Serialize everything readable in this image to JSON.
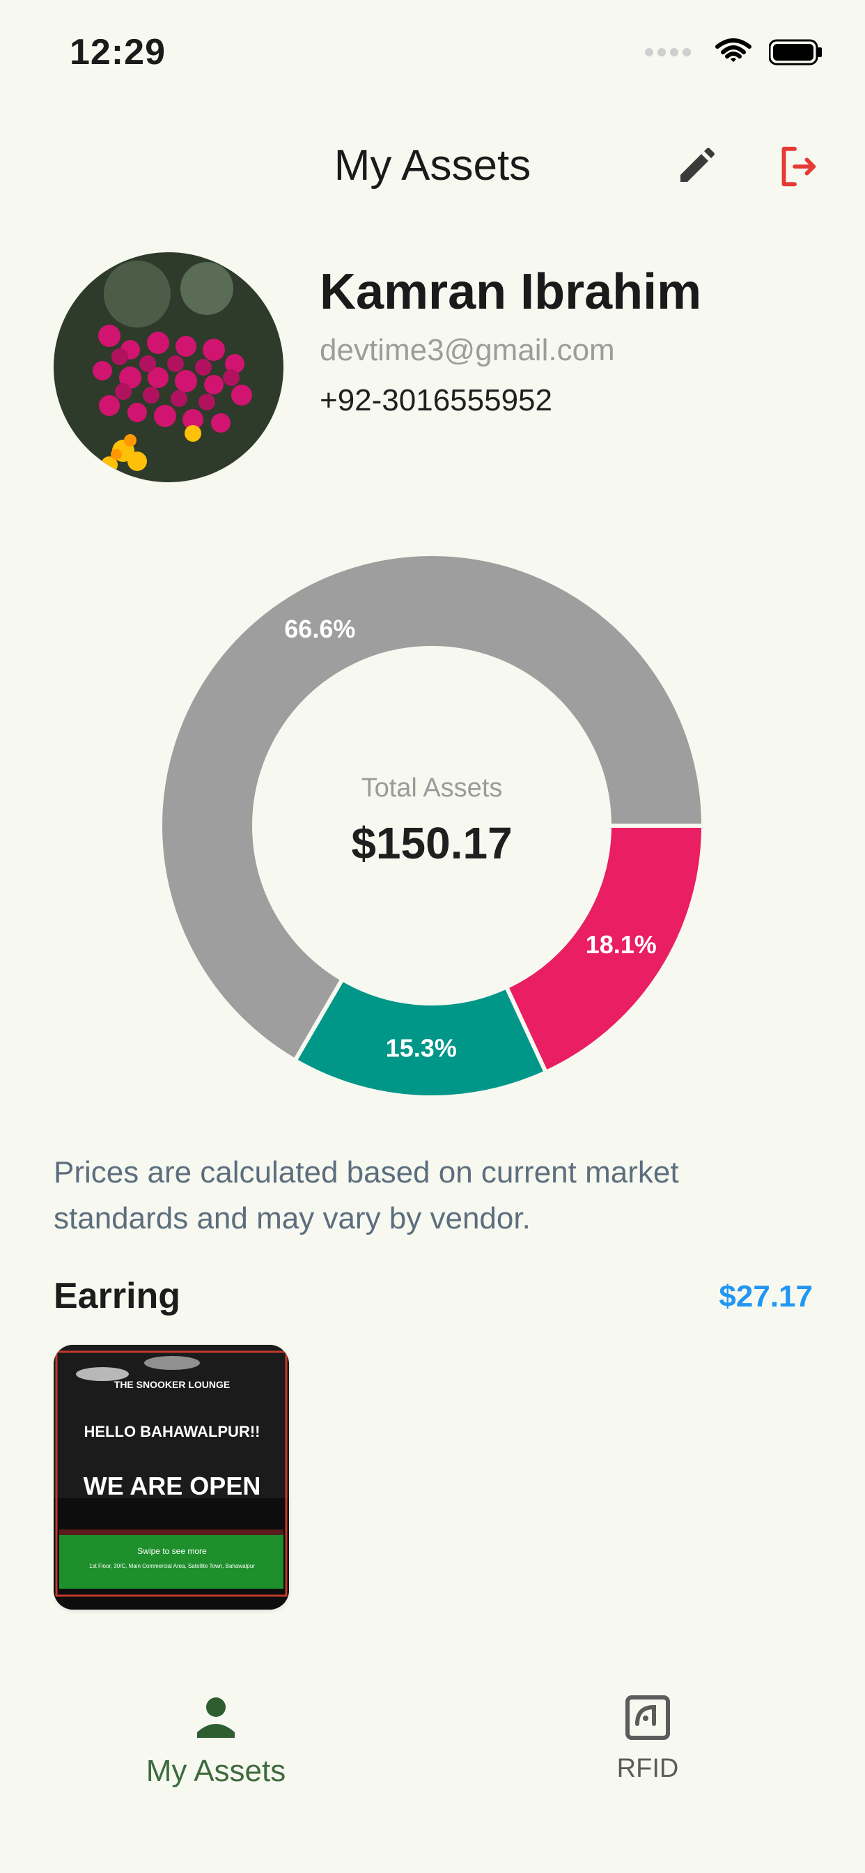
{
  "status_bar": {
    "time": "12:29"
  },
  "header": {
    "title": "My Assets",
    "icons": {
      "edit": "pencil-icon",
      "logout": "logout-icon"
    }
  },
  "profile": {
    "name": "Kamran Ibrahim",
    "email": "devtime3@gmail.com",
    "phone": "+92-3016555952",
    "avatar_icon": "flowers-photo"
  },
  "chart_data": {
    "type": "pie",
    "values": [
      66.6,
      18.1,
      15.3
    ],
    "labels": [
      "66.6%",
      "18.1%",
      "15.3%"
    ],
    "colors": [
      "#9E9E9E",
      "#E91E63",
      "#009688"
    ],
    "center_label": "Total Assets",
    "center_value": "$150.17"
  },
  "note": "Prices are calculated based on current market standards and may vary by vendor.",
  "assets": [
    {
      "title": "Earring",
      "price": "$27.17",
      "image": {
        "brand": "THE SNOOKER LOUNGE",
        "headline": "HELLO BAHAWALPUR!!",
        "main": "WE ARE OPEN",
        "subtext": "Swipe to see more",
        "address": "1st Floor, 30/C, Main Commercial Area, Satellite Town, Bahawalpur"
      }
    }
  ],
  "bottom_nav": {
    "items": [
      {
        "label": "My Assets",
        "icon": "person-icon",
        "active": true
      },
      {
        "label": "RFID",
        "icon": "rfid-icon",
        "active": false
      }
    ]
  }
}
